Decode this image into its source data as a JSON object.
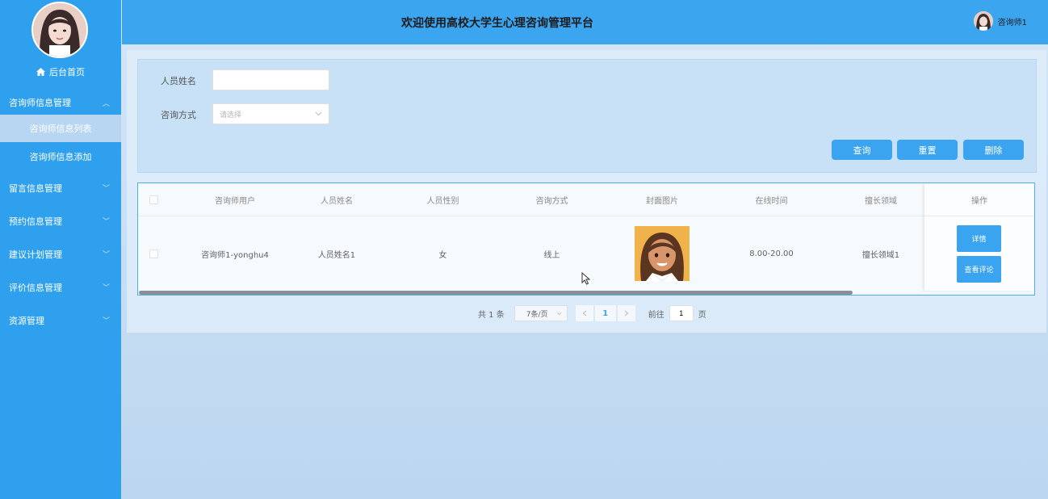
{
  "sidebar": {
    "home_label": "后台首页",
    "menus": [
      {
        "label": "咨询师信息管理",
        "expanded": true,
        "children": [
          {
            "label": "咨询师信息列表",
            "active": true
          },
          {
            "label": "咨询师信息添加",
            "active": false
          }
        ]
      },
      {
        "label": "留言信息管理"
      },
      {
        "label": "预约信息管理"
      },
      {
        "label": "建议计划管理"
      },
      {
        "label": "评价信息管理"
      },
      {
        "label": "资源管理"
      }
    ]
  },
  "header": {
    "title": "欢迎使用高校大学生心理咨询管理平台",
    "username": "咨询师1"
  },
  "search": {
    "name_label": "人员姓名",
    "name_value": "",
    "method_label": "咨询方式",
    "method_placeholder": "请选择",
    "query_button": "查询",
    "reset_button": "重置",
    "delete_button": "删除"
  },
  "table": {
    "columns": [
      "咨询师用户",
      "人员姓名",
      "人员性别",
      "咨询方式",
      "封面图片",
      "在线时间",
      "擅长领域",
      "操作"
    ],
    "rows": [
      {
        "user": "咨询师1-yonghu4",
        "name": "人员姓名1",
        "gender": "女",
        "method": "线上",
        "image": "cartoon-woman-avatar",
        "online_time": "8.00-20.00",
        "field": "擅长领域1"
      }
    ],
    "detail_button": "详情",
    "comments_button": "查看评论"
  },
  "pagination": {
    "total": "共 1 条",
    "page_size": "7条/页",
    "current_page": "1",
    "goto_prefix": "前往",
    "goto_value": "1",
    "goto_suffix": "页"
  },
  "colors": {
    "accent": "#3ba4f0",
    "sidebar": "#2fa0ee",
    "header": "#3ba5f0"
  }
}
